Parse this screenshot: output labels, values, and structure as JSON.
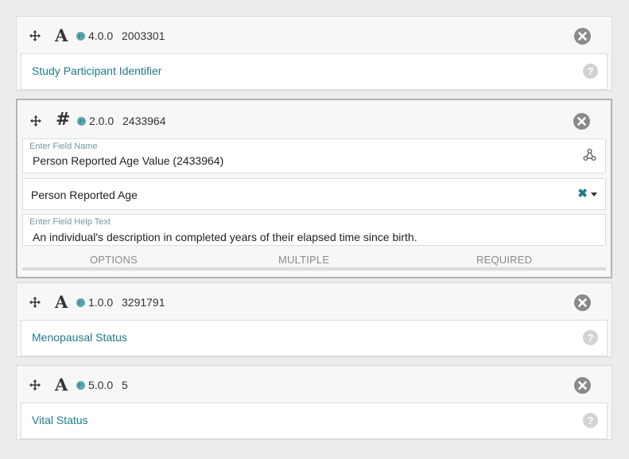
{
  "fields": [
    {
      "type_glyph": "A",
      "type_icon": "text-type-icon",
      "version": "4.0.0",
      "cde_id": "2003301",
      "name": "Study Participant Identifier"
    },
    {
      "type_glyph": "#",
      "type_icon": "number-type-icon",
      "version": "2.0.0",
      "cde_id": "2433964",
      "field_name_placeholder": "Enter Field Name",
      "field_name_value": "Person Reported Age Value (2433964)",
      "selected_concept": "Person Reported Age",
      "help_text_placeholder": "Enter Field Help Text",
      "help_text_value": "An individual's description in completed years of their elapsed time since birth.",
      "options": [
        "OPTIONS",
        "MULTIPLE",
        "REQUIRED"
      ]
    },
    {
      "type_glyph": "A",
      "type_icon": "text-type-icon",
      "version": "1.0.0",
      "cde_id": "3291791",
      "name": "Menopausal Status"
    },
    {
      "type_glyph": "A",
      "type_icon": "text-type-icon",
      "version": "5.0.0",
      "cde_id": "5",
      "name": "Vital Status"
    }
  ],
  "colors": {
    "link": "#1f7a8c",
    "label": "#6f9aa3",
    "close_icon": "#8a8a8a",
    "help_icon": "#d0d0d0",
    "globe": "#5ea8b0"
  }
}
